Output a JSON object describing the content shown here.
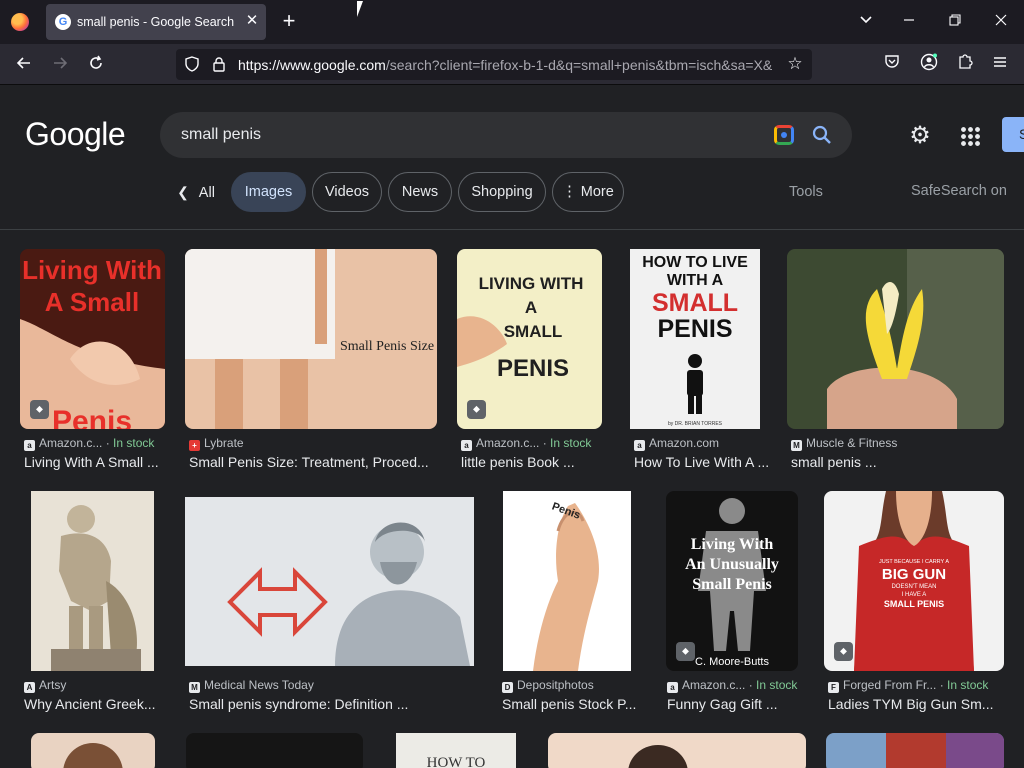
{
  "browser": {
    "tab_title": "small penis - Google Search",
    "tab_favicon": "G",
    "url_host": "https://www.google.com",
    "url_path": "/search?client=firefox-b-1-d&q=small+penis&tbm=isch&sa=X&",
    "icons": [
      "firefox-logo",
      "tab-close",
      "new-tab",
      "list-all-tabs",
      "minimize",
      "restore",
      "close",
      "back",
      "forward",
      "reload",
      "tracking-shield",
      "lock",
      "bookmark-star",
      "pocket",
      "account",
      "extensions",
      "menu"
    ]
  },
  "google": {
    "logo": "Google",
    "query": "small penis",
    "signin_label": "S",
    "chips": {
      "all": "All",
      "images": "Images",
      "videos": "Videos",
      "news": "News",
      "shopping": "Shopping",
      "more": "More"
    },
    "tools": "Tools",
    "safesearch": "SafeSearch on"
  },
  "results": [
    {
      "source": "Amazon.c...",
      "stock": "In stock",
      "caption": "Living With A Small ...",
      "thumb_text": [
        "Living With",
        "A Small",
        "Penis"
      ],
      "colors": [
        "#3a1410",
        "#e8302a"
      ]
    },
    {
      "source": "Lybrate",
      "stock": "",
      "caption": "Small Penis Size: Treatment, Proced...",
      "thumb_text": [
        "Small Penis Size"
      ],
      "colors": [
        "#e9c2a6",
        "#f4f1ee"
      ]
    },
    {
      "source": "Amazon.c...",
      "stock": "In stock",
      "caption": "little penis Book ...",
      "thumb_text": [
        "LIVING WITH",
        "A",
        "SMALL",
        "PENIS"
      ],
      "colors": [
        "#f3efc7",
        "#202020"
      ]
    },
    {
      "source": "Amazon.com",
      "stock": "",
      "caption": "How To Live With A ...",
      "thumb_text": [
        "HOW TO LIVE",
        "WITH A",
        "SMALL",
        "PENIS",
        "by DR. BRIAN TORRES"
      ],
      "colors": [
        "#f1f1f1",
        "#d32f2f"
      ]
    },
    {
      "source": "Muscle & Fitness",
      "stock": "",
      "caption": "small penis ...",
      "thumb_text": [],
      "colors": [
        "#3d4a32",
        "#f5d938"
      ]
    },
    {
      "source": "Artsy",
      "stock": "",
      "caption": "Why Ancient Greek...",
      "thumb_text": [],
      "colors": [
        "#d9cdb8",
        "#b5a68c"
      ]
    },
    {
      "source": "Medical News Today",
      "stock": "",
      "caption": "Small penis syndrome: Definition ...",
      "thumb_text": [],
      "colors": [
        "#e3e6e9",
        "#d9463a"
      ]
    },
    {
      "source": "Depositphotos",
      "stock": "",
      "caption": "Small penis Stock P...",
      "thumb_text": [
        "Penis"
      ],
      "colors": [
        "#ffffff",
        "#e8b48e"
      ]
    },
    {
      "source": "Amazon.c...",
      "stock": "In stock",
      "caption": "Funny Gag Gift ...",
      "thumb_text": [
        "Living With",
        "An Unusually",
        "Small Penis",
        "C. Moore-Butts"
      ],
      "colors": [
        "#121212",
        "#8a8a8a"
      ]
    },
    {
      "source": "Forged From Fr...",
      "stock": "In stock",
      "caption": "Ladies TYM Big Gun Sm...",
      "thumb_text": [
        "JUST BECAUSE I CARRY A",
        "BIG GUN",
        "DOESN'T MEAN",
        "I HAVE A",
        "SMALL PENIS"
      ],
      "colors": [
        "#f2f2f2",
        "#c62828"
      ]
    }
  ],
  "partial_row_colors": [
    "#e9d3c2",
    "#151515",
    "#ecebe6",
    "#f0d9c8",
    "#7ca0c8"
  ],
  "partial_row_text": [
    "HOW TO"
  ]
}
